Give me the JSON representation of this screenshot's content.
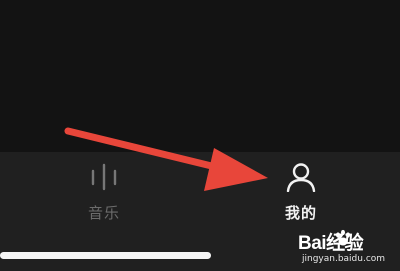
{
  "tabs": {
    "music": {
      "label": "音乐",
      "icon": "music-bars-icon",
      "color": "#6b6b6b"
    },
    "mine": {
      "label": "我的",
      "icon": "user-icon",
      "color": "#f2f2f2"
    }
  },
  "annotation": {
    "icon": "red-arrow-icon",
    "color": "#e8463a"
  },
  "watermark": {
    "brand": "Bai经验",
    "site": "jingyan.baidu.com"
  },
  "colors": {
    "background": "#141414",
    "tab_bar": "#202020",
    "home_indicator": "#f5f5f5"
  }
}
